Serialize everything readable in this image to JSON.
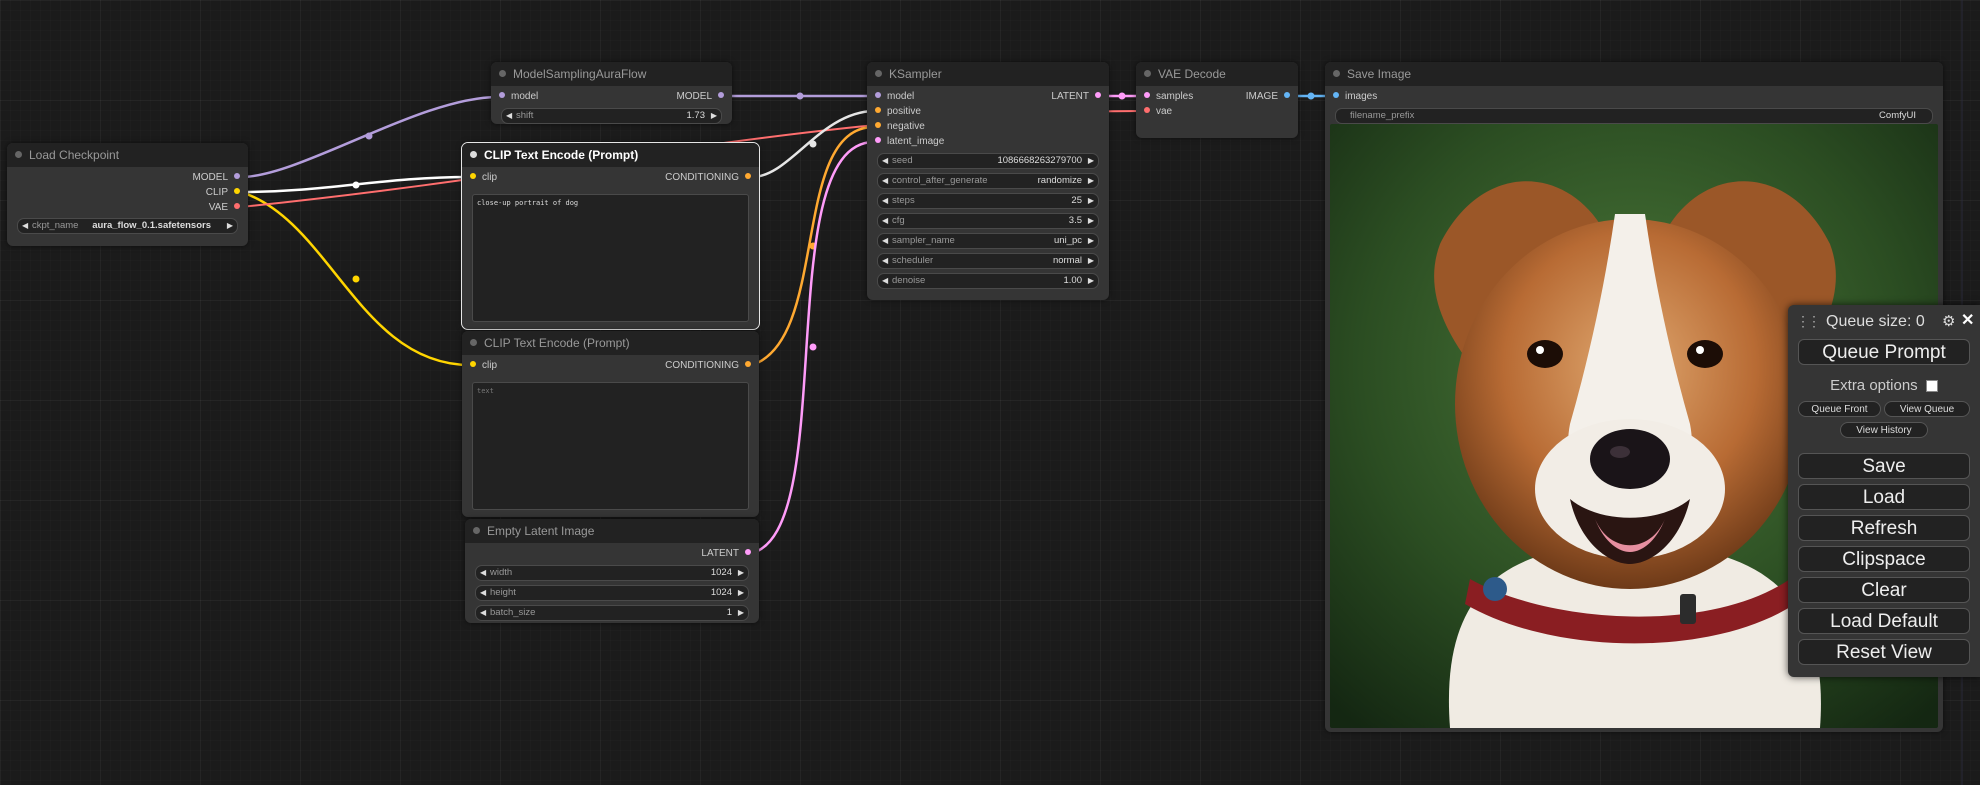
{
  "colors": {
    "model": "#b39ddb",
    "clip": "#ffd500",
    "vae": "#ff6e6e",
    "conditioning": "#ffa931",
    "latent": "#ff9cf9",
    "image": "#64b5f6",
    "conditioning_link": "#e6e6e6"
  },
  "nodes": {
    "model_sampling": {
      "title": "ModelSamplingAuraFlow",
      "input_model": "model",
      "output_model": "MODEL",
      "widget_shift": {
        "name": "shift",
        "value": "1.73"
      }
    },
    "ksampler": {
      "title": "KSampler",
      "inputs": [
        "model",
        "positive",
        "negative",
        "latent_image"
      ],
      "output": "LATENT",
      "widgets": [
        {
          "name": "seed",
          "value": "1086668263279700"
        },
        {
          "name": "control_after_generate",
          "value": "randomize"
        },
        {
          "name": "steps",
          "value": "25"
        },
        {
          "name": "cfg",
          "value": "3.5"
        },
        {
          "name": "sampler_name",
          "value": "uni_pc"
        },
        {
          "name": "scheduler",
          "value": "normal"
        },
        {
          "name": "denoise",
          "value": "1.00"
        }
      ]
    },
    "vae_decode": {
      "title": "VAE Decode",
      "input_samples": "samples",
      "input_vae": "vae",
      "output": "IMAGE"
    },
    "save_image": {
      "title": "Save Image",
      "input_images": "images",
      "widget_prefix": {
        "name": "filename_prefix",
        "value": "ComfyUI"
      }
    },
    "load_checkpoint": {
      "title": "Load Checkpoint",
      "outputs": [
        "MODEL",
        "CLIP",
        "VAE"
      ],
      "widget_ckpt": {
        "name": "ckpt_name",
        "value": "aura_flow_0.1.safetensors"
      }
    },
    "clip_positive": {
      "title": "CLIP Text Encode (Prompt)",
      "input_clip": "clip",
      "output": "CONDITIONING",
      "text": "close-up portrait of dog"
    },
    "clip_negative": {
      "title": "CLIP Text Encode (Prompt)",
      "input_clip": "clip",
      "output": "CONDITIONING",
      "text": "text"
    },
    "empty_latent": {
      "title": "Empty Latent Image",
      "output": "LATENT",
      "widgets": [
        {
          "name": "width",
          "value": "1024"
        },
        {
          "name": "height",
          "value": "1024"
        },
        {
          "name": "batch_size",
          "value": "1"
        }
      ]
    }
  },
  "menu": {
    "drag_icon": "drag-handle-icon",
    "queue_size": "Queue size: 0",
    "settings_icon": "gear-icon",
    "close_icon": "close-icon",
    "queue_prompt": "Queue Prompt",
    "extra_options": "Extra options",
    "queue_front": "Queue Front",
    "view_queue": "View Queue",
    "view_history": "View History",
    "save": "Save",
    "load": "Load",
    "refresh": "Refresh",
    "clipspace": "Clipspace",
    "clear": "Clear",
    "load_default": "Load Default",
    "reset_view": "Reset View"
  }
}
